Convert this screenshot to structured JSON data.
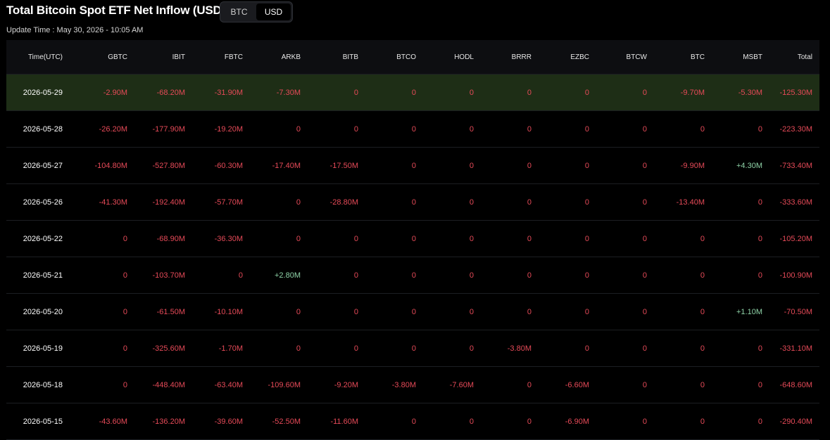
{
  "header": {
    "title": "Total Bitcoin Spot ETF Net Inflow (USD)",
    "toggle": {
      "options": [
        "BTC",
        "USD"
      ],
      "selected": "USD"
    },
    "update_time": "Update Time : May 30, 2026 - 10:05 AM"
  },
  "table": {
    "columns": [
      "Time(UTC)",
      "GBTC",
      "IBIT",
      "FBTC",
      "ARKB",
      "BITB",
      "BTCO",
      "HODL",
      "BRRR",
      "EZBC",
      "BTCW",
      "BTC",
      "MSBT",
      "Total"
    ],
    "rows": [
      [
        "2026-05-29",
        "-2.90M",
        "-68.20M",
        "-31.90M",
        "-7.30M",
        "0",
        "0",
        "0",
        "0",
        "0",
        "0",
        "-9.70M",
        "-5.30M",
        "-125.30M"
      ],
      [
        "2026-05-28",
        "-26.20M",
        "-177.90M",
        "-19.20M",
        "0",
        "0",
        "0",
        "0",
        "0",
        "0",
        "0",
        "0",
        "0",
        "-223.30M"
      ],
      [
        "2026-05-27",
        "-104.80M",
        "-527.80M",
        "-60.30M",
        "-17.40M",
        "-17.50M",
        "0",
        "0",
        "0",
        "0",
        "0",
        "-9.90M",
        "+4.30M",
        "-733.40M"
      ],
      [
        "2026-05-26",
        "-41.30M",
        "-192.40M",
        "-57.70M",
        "0",
        "-28.80M",
        "0",
        "0",
        "0",
        "0",
        "0",
        "-13.40M",
        "0",
        "-333.60M"
      ],
      [
        "2026-05-22",
        "0",
        "-68.90M",
        "-36.30M",
        "0",
        "0",
        "0",
        "0",
        "0",
        "0",
        "0",
        "0",
        "0",
        "-105.20M"
      ],
      [
        "2026-05-21",
        "0",
        "-103.70M",
        "0",
        "+2.80M",
        "0",
        "0",
        "0",
        "0",
        "0",
        "0",
        "0",
        "0",
        "-100.90M"
      ],
      [
        "2026-05-20",
        "0",
        "-61.50M",
        "-10.10M",
        "0",
        "0",
        "0",
        "0",
        "0",
        "0",
        "0",
        "0",
        "+1.10M",
        "-70.50M"
      ],
      [
        "2026-05-19",
        "0",
        "-325.60M",
        "-1.70M",
        "0",
        "0",
        "0",
        "0",
        "-3.80M",
        "0",
        "0",
        "0",
        "0",
        "-331.10M"
      ],
      [
        "2026-05-18",
        "0",
        "-448.40M",
        "-63.40M",
        "-109.60M",
        "-9.20M",
        "-3.80M",
        "-7.60M",
        "0",
        "-6.60M",
        "0",
        "0",
        "0",
        "-648.60M"
      ],
      [
        "2026-05-15",
        "-43.60M",
        "-136.20M",
        "-39.60M",
        "-52.50M",
        "-11.60M",
        "0",
        "0",
        "0",
        "-6.90M",
        "0",
        "0",
        "0",
        "-290.40M"
      ]
    ]
  },
  "colors": {
    "negative": "#e64a58",
    "positive": "#8fd3a8",
    "highlight_row": "#1e2e16"
  }
}
